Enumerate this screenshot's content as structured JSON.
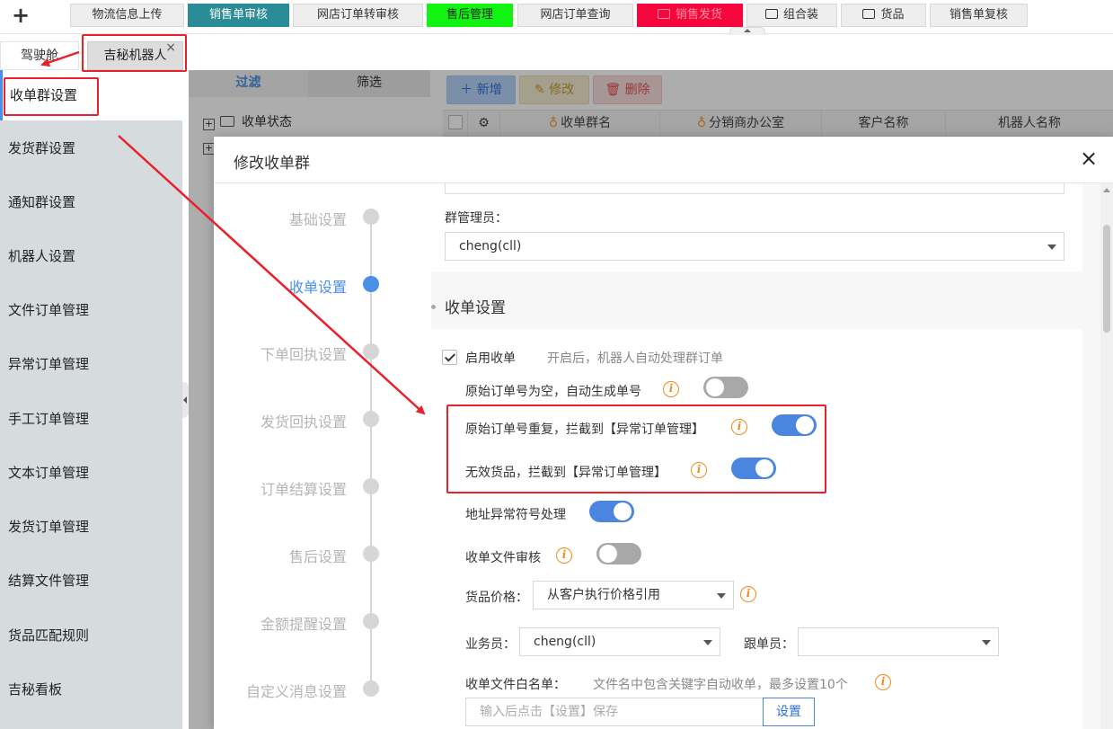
{
  "top_tabs": [
    {
      "label": "物流信息上传",
      "style": "default"
    },
    {
      "label": "销售单审核",
      "style": "teal"
    },
    {
      "label": "网店订单转审核",
      "style": "default"
    },
    {
      "label": "售后管理",
      "style": "green"
    },
    {
      "label": "网店订单查询",
      "style": "default"
    },
    {
      "label": "销售发货",
      "style": "red"
    },
    {
      "label": "组合装",
      "style": "default"
    },
    {
      "label": "货品",
      "style": "default"
    },
    {
      "label": "销售单复核",
      "style": "default"
    }
  ],
  "sub_tabs": {
    "tab1": "驾驶舱",
    "tab2": "吉秘机器人",
    "close": "×"
  },
  "sidebar": {
    "items": [
      {
        "label": "收单群设置"
      },
      {
        "label": "发货群设置"
      },
      {
        "label": "通知群设置"
      },
      {
        "label": "机器人设置"
      },
      {
        "label": "文件订单管理"
      },
      {
        "label": "异常订单管理"
      },
      {
        "label": "手工订单管理"
      },
      {
        "label": "文本订单管理"
      },
      {
        "label": "发货订单管理"
      },
      {
        "label": "结算文件管理"
      },
      {
        "label": "货品匹配规则"
      },
      {
        "label": "吉秘看板"
      }
    ]
  },
  "background": {
    "filter_tab": "过滤",
    "screen_tab": "筛选",
    "tree_item": "收单状态",
    "buttons": {
      "add": "新增",
      "edit": "修改",
      "delete": "删除"
    },
    "grid_headers": [
      "收单群名",
      "分销商办公室",
      "客户名称",
      "机器人名称"
    ]
  },
  "modal": {
    "title": "修改收单群",
    "close": "×",
    "steps": [
      {
        "label": "基础设置",
        "active": false
      },
      {
        "label": "收单设置",
        "active": true
      },
      {
        "label": "下单回执设置",
        "active": false
      },
      {
        "label": "发货回执设置",
        "active": false
      },
      {
        "label": "订单结算设置",
        "active": false
      },
      {
        "label": "售后设置",
        "active": false
      },
      {
        "label": "金额提醒设置",
        "active": false
      },
      {
        "label": "自定义消息设置",
        "active": false
      }
    ],
    "group_admin_label": "群管理员：",
    "group_admin_value": "cheng(cll)",
    "section_title": "收单设置",
    "enable_label": "启用收单",
    "enable_hint": "开启后，机器人自动处理群订单",
    "options": [
      {
        "label": "原始订单号为空，自动生成单号",
        "on": false
      },
      {
        "label": "原始订单号重复，拦截到【异常订单管理】",
        "on": true
      },
      {
        "label": "无效货品，拦截到【异常订单管理】",
        "on": true
      },
      {
        "label": "地址异常符号处理",
        "on": true
      },
      {
        "label": "收单文件审核",
        "on": false
      }
    ],
    "price_label": "货品价格：",
    "price_value": "从客户执行价格引用",
    "sales_label": "业务员：",
    "sales_value": "cheng(cll)",
    "follower_label": "跟单员：",
    "follower_value": "",
    "whitelist_label": "收单文件白名单：",
    "whitelist_hint": "文件名中包含关键字自动收单，最多设置10个",
    "whitelist_placeholder": "输入后点击【设置】保存",
    "set_button": "设置"
  },
  "colors": {
    "accent": "#4a8fe7",
    "annotation": "#e8202a",
    "toggle_on": "#4a85e0",
    "info": "#f08a1c"
  }
}
